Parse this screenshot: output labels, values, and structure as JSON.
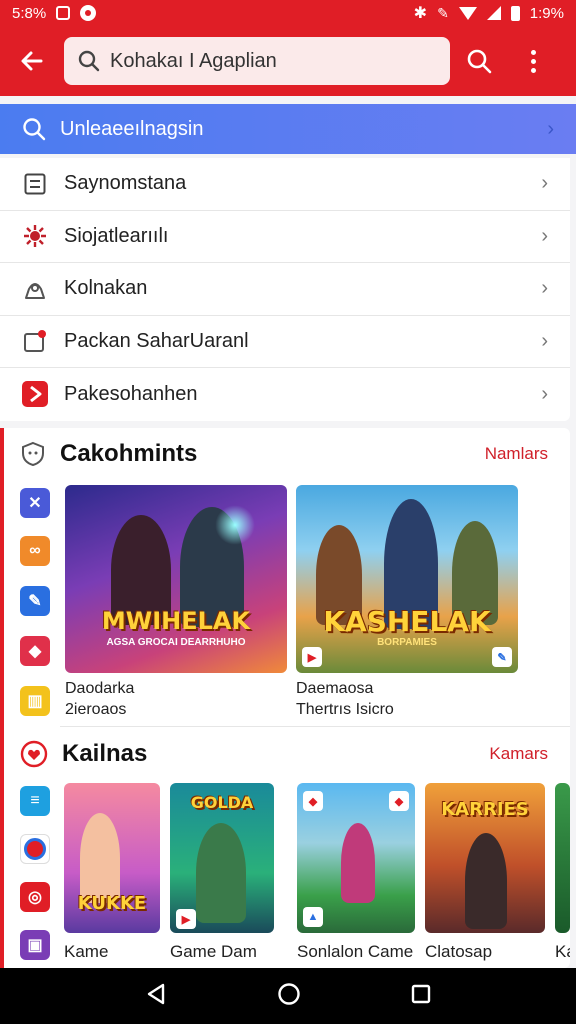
{
  "status_bar": {
    "time": "5:8%",
    "battery": "1:9%"
  },
  "toolbar": {
    "search_text": "Kohakaı I Agaplian"
  },
  "suggestion": {
    "text": "Unleaeeılnagsin"
  },
  "menu_items": [
    {
      "label": "Saynomstana",
      "icon": "list-icon"
    },
    {
      "label": "Siojatlearıılı",
      "icon": "settings-cog-icon"
    },
    {
      "label": "Kolnakan",
      "icon": "user-outline-icon"
    },
    {
      "label": "Packan SaharUaranl",
      "icon": "package-badge-icon"
    },
    {
      "label": "Pakesohanhen",
      "icon": "play-icon"
    }
  ],
  "section1": {
    "title": "Cakohmints",
    "link": "Namlars",
    "cards": [
      {
        "art_title": "MWIHELAK",
        "art_sub": "AGSA GROCAI DEARRHUHO",
        "caption1": "Daodarka",
        "caption2": "2ieroaos"
      },
      {
        "art_title": "KASHELAK",
        "art_sub": "BORPAMIES",
        "caption1": "Daemaosa",
        "caption2": "Thertrıs Isicro"
      }
    ]
  },
  "section2": {
    "title": "Kailnas",
    "link": "Kamars",
    "cards": [
      {
        "art_title": "KUKKE",
        "caption": "Kame"
      },
      {
        "art_title": "GOLDA",
        "caption": "Game Dam"
      },
      {
        "art_title": "",
        "caption": "Sonlalon Came"
      },
      {
        "art_title": "KARRIES",
        "caption": "Clatosap"
      },
      {
        "art_title": "",
        "caption": "Ka"
      }
    ]
  },
  "colors": {
    "brand_red": "#e01e26",
    "accent_blue": "#4b7cf0"
  }
}
